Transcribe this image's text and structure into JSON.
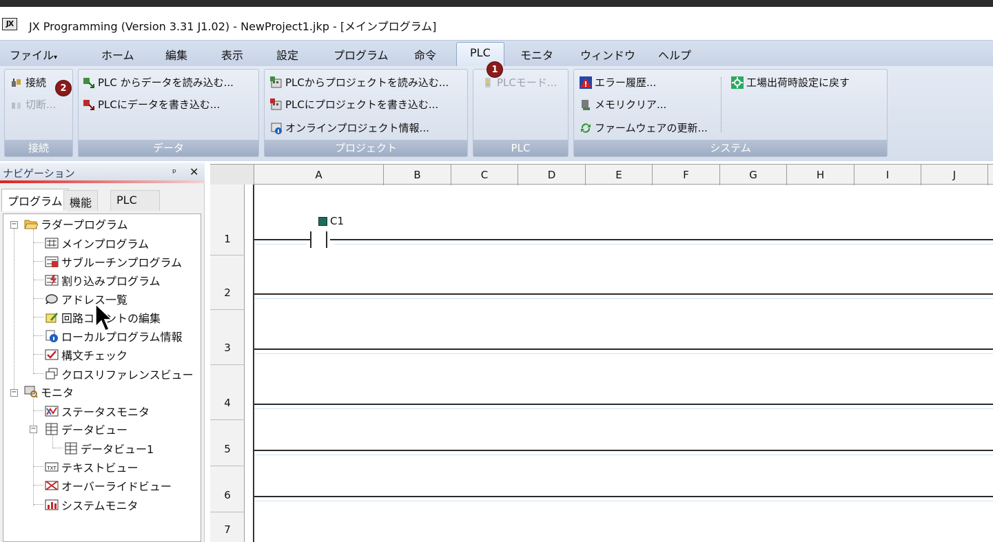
{
  "window": {
    "app_icon_text": "JX",
    "title": "JX Programming (Version 3.31 J1.02) - NewProject1.jkp - [メインプログラム]"
  },
  "menu": {
    "items": [
      "ファイル",
      "ホーム",
      "編集",
      "表示",
      "設定",
      "プログラム",
      "命令",
      "PLC",
      "モニタ",
      "ウィンドウ",
      "ヘルプ"
    ],
    "active": "PLC"
  },
  "ribbon": {
    "groups": {
      "connect": {
        "label": "接続",
        "connect_button": "接続",
        "disconnect_button": "切断..."
      },
      "data": {
        "label": "データ",
        "read_data": "PLC からデータを読み込む...",
        "write_data": "PLCにデータを書き込む..."
      },
      "project": {
        "label": "プロジェクト",
        "read_project": "PLCからプロジェクトを読み込む...",
        "write_project": "PLCにプロジェクトを書き込む...",
        "online_info": "オンラインプロジェクト情報..."
      },
      "plc": {
        "label": "PLC",
        "plc_mode": "PLCモード..."
      },
      "system": {
        "label": "システム",
        "error_history": "エラー履歴...",
        "memory_clear": "メモリクリア...",
        "firmware_update": "ファームウェアの更新...",
        "factory_reset": "工場出荷時設定に戻す"
      }
    }
  },
  "badges": [
    "1",
    "2"
  ],
  "navigation": {
    "title": "ナビゲーション",
    "pin_glyph": "ᵖ",
    "close_glyph": "✕",
    "tabs": [
      "プログラム",
      "機能",
      "PLC"
    ],
    "active_tab": "プログラム",
    "tree": {
      "ladder_root": "ラダープログラム",
      "ladder_items": [
        "メインプログラム",
        "サブルーチンプログラム",
        "割り込みプログラム",
        "アドレス一覧",
        "回路コメントの編集",
        "ローカルプログラム情報",
        "構文チェック",
        "クロスリファレンスビュー"
      ],
      "monitor_root": "モニタ",
      "status_monitor": "ステータスモニタ",
      "dataview_root": "データビュー",
      "dataview_1": "データビュー1",
      "text_view": "テキストビュー",
      "override_view": "オーバーライドビュー",
      "system_monitor": "システムモニタ"
    }
  },
  "ladder": {
    "columns": [
      "A",
      "B",
      "C",
      "D",
      "E",
      "F",
      "G",
      "H",
      "I",
      "J"
    ],
    "rows": [
      "1",
      "2",
      "3",
      "4",
      "5",
      "6",
      "7"
    ],
    "contact_label": "C1"
  }
}
